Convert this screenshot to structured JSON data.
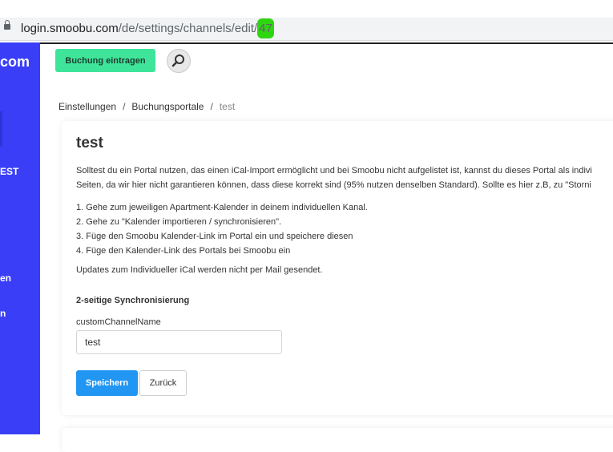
{
  "browser": {
    "url_host": "login.smoobu.com",
    "url_path": "/de/settings/channels/edit/",
    "url_id": "47"
  },
  "sidebar": {
    "brand": "com",
    "items": [
      {
        "label": "EST"
      },
      {
        "label": "en"
      },
      {
        "label": "n"
      }
    ]
  },
  "header": {
    "add_booking_label": "Buchung eintragen",
    "search_icon": "search-icon"
  },
  "breadcrumb": {
    "items": [
      "Einstellungen",
      "Buchungsportale",
      "test"
    ],
    "separator": "/"
  },
  "card": {
    "title": "test",
    "intro_line1": "Solltest du ein Portal nutzen, das einen iCal-Import ermöglicht und bei Smoobu nicht aufgelistet ist, kannst du dieses Portal als indivi",
    "intro_line2": "Seiten, da wir hier nicht garantieren können, dass diese korrekt sind (95% nutzen denselben Standard). Sollte es hier z.B, zu \"Storni",
    "steps": [
      "1. Gehe zum jeweiligen Apartment-Kalender in deinem individuellen Kanal.",
      "2. Gehe zu \"Kalender importieren / synchronisieren\".",
      "3. Füge den Smoobu Kalender-Link im Portal ein und speichere diesen",
      "4. Füge den Kalender-Link des Portals bei Smoobu ein"
    ],
    "note": "Updates zum Individueller iCal werden nicht per Mail gesendet.",
    "sync_title": "2-seitige Synchronisierung",
    "field_label": "customChannelName",
    "field_value": "test",
    "save_label": "Speichern",
    "back_label": "Zurück"
  },
  "colors": {
    "sidebar": "#3a3ff7",
    "add_button": "#3ee49a",
    "save_button": "#2196f3",
    "url_highlight": "#2ed612"
  }
}
